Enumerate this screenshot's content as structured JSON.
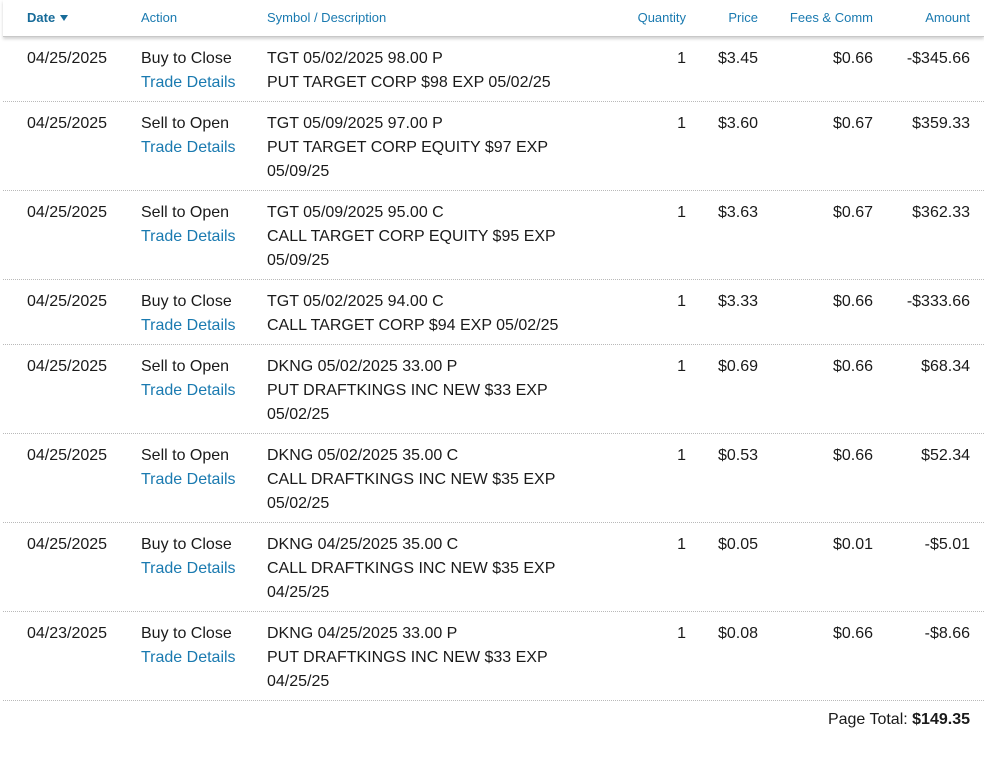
{
  "header": {
    "date": "Date",
    "action": "Action",
    "symbol": "Symbol / Description",
    "quantity": "Quantity",
    "price": "Price",
    "fees": "Fees & Comm",
    "amount": "Amount"
  },
  "link_label": "Trade Details",
  "rows": [
    {
      "date": "04/25/2025",
      "action": "Buy to Close",
      "symbol": "TGT 05/02/2025 98.00 P",
      "desc": [
        "PUT TARGET CORP $98 EXP 05/02/25"
      ],
      "qty": "1",
      "price": "$3.45",
      "fees": "$0.66",
      "amount": "-$345.66"
    },
    {
      "date": "04/25/2025",
      "action": "Sell to Open",
      "symbol": "TGT 05/09/2025 97.00 P",
      "desc": [
        "PUT TARGET CORP EQUITY $97 EXP",
        "05/09/25"
      ],
      "qty": "1",
      "price": "$3.60",
      "fees": "$0.67",
      "amount": "$359.33"
    },
    {
      "date": "04/25/2025",
      "action": "Sell to Open",
      "symbol": "TGT 05/09/2025 95.00 C",
      "desc": [
        "CALL TARGET CORP EQUITY $95 EXP",
        "05/09/25"
      ],
      "qty": "1",
      "price": "$3.63",
      "fees": "$0.67",
      "amount": "$362.33"
    },
    {
      "date": "04/25/2025",
      "action": "Buy to Close",
      "symbol": "TGT 05/02/2025 94.00 C",
      "desc": [
        "CALL TARGET CORP $94 EXP 05/02/25"
      ],
      "qty": "1",
      "price": "$3.33",
      "fees": "$0.66",
      "amount": "-$333.66"
    },
    {
      "date": "04/25/2025",
      "action": "Sell to Open",
      "symbol": "DKNG 05/02/2025 33.00 P",
      "desc": [
        "PUT DRAFTKINGS INC NEW $33 EXP",
        "05/02/25"
      ],
      "qty": "1",
      "price": "$0.69",
      "fees": "$0.66",
      "amount": "$68.34"
    },
    {
      "date": "04/25/2025",
      "action": "Sell to Open",
      "symbol": "DKNG 05/02/2025 35.00 C",
      "desc": [
        "CALL DRAFTKINGS INC NEW $35 EXP",
        "05/02/25"
      ],
      "qty": "1",
      "price": "$0.53",
      "fees": "$0.66",
      "amount": "$52.34"
    },
    {
      "date": "04/25/2025",
      "action": "Buy to Close",
      "symbol": "DKNG 04/25/2025 35.00 C",
      "desc": [
        "CALL DRAFTKINGS INC NEW $35 EXP",
        "04/25/25"
      ],
      "qty": "1",
      "price": "$0.05",
      "fees": "$0.01",
      "amount": "-$5.01"
    },
    {
      "date": "04/23/2025",
      "action": "Buy to Close",
      "symbol": "DKNG 04/25/2025 33.00 P",
      "desc": [
        "PUT DRAFTKINGS INC NEW $33 EXP",
        "04/25/25"
      ],
      "qty": "1",
      "price": "$0.08",
      "fees": "$0.66",
      "amount": "-$8.66"
    }
  ],
  "footer": {
    "label": "Page Total:",
    "value": "$149.35"
  },
  "colors": {
    "link": "#1a7ab0",
    "header_text": "#1a7ab0"
  }
}
